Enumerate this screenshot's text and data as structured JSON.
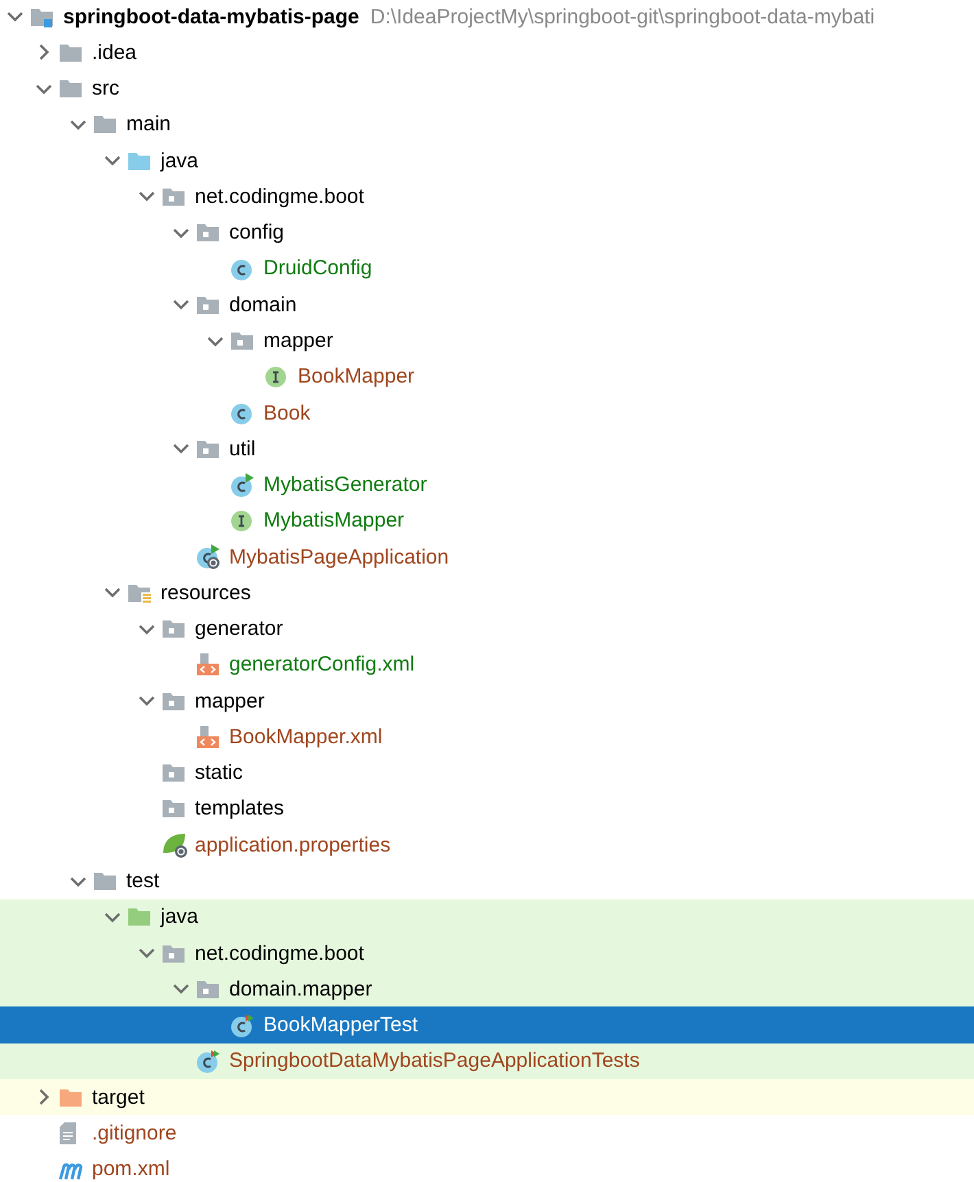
{
  "tree": [
    {
      "label": "springboot-data-mybatis-page",
      "path": "D:\\IdeaProjectMy\\springboot-git\\springboot-data-mybati",
      "kind": "module",
      "expanded": true,
      "selected": false,
      "children": [
        {
          "label": ".idea",
          "kind": "folder",
          "expanded": false,
          "selected": false
        },
        {
          "label": "src",
          "kind": "folder",
          "expanded": true,
          "selected": false,
          "children": [
            {
              "label": "main",
              "kind": "folder",
              "expanded": true,
              "selected": false,
              "children": [
                {
                  "label": "java",
                  "kind": "source-folder",
                  "expanded": true,
                  "selected": false,
                  "children": [
                    {
                      "label": "net.codingme.boot",
                      "kind": "package",
                      "expanded": true,
                      "selected": false,
                      "children": [
                        {
                          "label": "config",
                          "kind": "package",
                          "expanded": true,
                          "selected": false,
                          "children": [
                            {
                              "label": "DruidConfig",
                              "kind": "class",
                              "color": "#107c10",
                              "selected": false
                            }
                          ]
                        },
                        {
                          "label": "domain",
                          "kind": "package",
                          "expanded": true,
                          "selected": false,
                          "children": [
                            {
                              "label": "mapper",
                              "kind": "package",
                              "expanded": true,
                              "selected": false,
                              "children": [
                                {
                                  "label": "BookMapper",
                                  "kind": "interface",
                                  "color": "#a0461e",
                                  "selected": false
                                }
                              ]
                            },
                            {
                              "label": "Book",
                              "kind": "class",
                              "color": "#a0461e",
                              "selected": false
                            }
                          ]
                        },
                        {
                          "label": "util",
                          "kind": "package",
                          "expanded": true,
                          "selected": false,
                          "children": [
                            {
                              "label": "MybatisGenerator",
                              "kind": "runnable-class",
                              "color": "#107c10",
                              "selected": false
                            },
                            {
                              "label": "MybatisMapper",
                              "kind": "interface",
                              "color": "#107c10",
                              "selected": false
                            }
                          ]
                        },
                        {
                          "label": "MybatisPageApplication",
                          "kind": "spring-app",
                          "color": "#a0461e",
                          "selected": false
                        }
                      ]
                    }
                  ]
                },
                {
                  "label": "resources",
                  "kind": "resources-folder",
                  "expanded": true,
                  "selected": false,
                  "children": [
                    {
                      "label": "generator",
                      "kind": "package",
                      "expanded": true,
                      "selected": false,
                      "children": [
                        {
                          "label": "generatorConfig.xml",
                          "kind": "xml",
                          "color": "#107c10",
                          "selected": false
                        }
                      ]
                    },
                    {
                      "label": "mapper",
                      "kind": "package",
                      "expanded": true,
                      "selected": false,
                      "children": [
                        {
                          "label": "BookMapper.xml",
                          "kind": "xml",
                          "color": "#a0461e",
                          "selected": false
                        }
                      ]
                    },
                    {
                      "label": "static",
                      "kind": "package",
                      "selected": false
                    },
                    {
                      "label": "templates",
                      "kind": "package",
                      "selected": false
                    },
                    {
                      "label": "application.properties",
                      "kind": "spring-properties",
                      "color": "#a0461e",
                      "selected": false
                    }
                  ]
                }
              ]
            },
            {
              "label": "test",
              "kind": "folder",
              "expanded": true,
              "selected": false,
              "children": [
                {
                  "label": "java",
                  "kind": "test-folder",
                  "test_scope": true,
                  "expanded": true,
                  "selected": false,
                  "children": [
                    {
                      "label": "net.codingme.boot",
                      "kind": "package",
                      "test_scope": true,
                      "expanded": true,
                      "selected": false,
                      "children": [
                        {
                          "label": "domain.mapper",
                          "kind": "package",
                          "test_scope": true,
                          "expanded": true,
                          "selected": false,
                          "children": [
                            {
                              "label": "BookMapperTest",
                              "kind": "test-class",
                              "test_scope": true,
                              "selected": true
                            }
                          ]
                        },
                        {
                          "label": "SpringbootDataMybatisPageApplicationTests",
                          "kind": "test-class",
                          "test_scope": true,
                          "color": "#a0461e",
                          "selected": false
                        }
                      ]
                    }
                  ]
                }
              ]
            }
          ]
        },
        {
          "label": "target",
          "kind": "excluded-folder",
          "excluded": true,
          "expanded": false,
          "selected": false
        },
        {
          "label": ".gitignore",
          "kind": "text-file",
          "color": "#a0461e",
          "selected": false
        },
        {
          "label": "pom.xml",
          "kind": "maven",
          "color": "#a0461e",
          "selected": false
        }
      ]
    }
  ]
}
